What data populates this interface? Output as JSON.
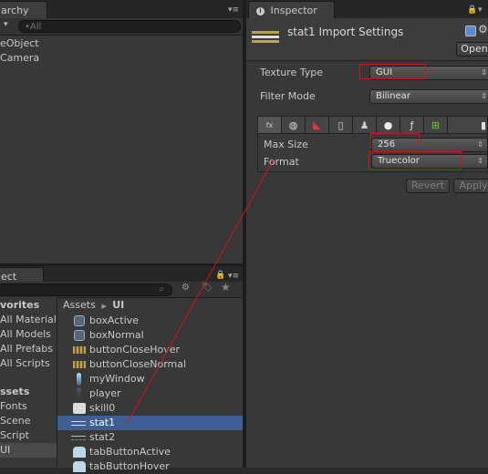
{
  "hierarchy": {
    "tab_label": "archy",
    "create_label": "▾",
    "search_placeholder": "•All",
    "items": [
      "eObject",
      "Camera"
    ]
  },
  "project": {
    "tab_label": "ect",
    "favorites": {
      "header": "vorites",
      "items": [
        "All Material",
        "All Models",
        "All Prefabs",
        "All Scripts"
      ]
    },
    "assets": {
      "header": "ssets",
      "items": [
        "Fonts",
        "Scene",
        "Script",
        "UI"
      ]
    },
    "breadcrumb": {
      "root": "Assets",
      "separator": "▶",
      "current": "UI"
    },
    "files": [
      {
        "name": "boxActive",
        "icon": "circle-frame-icon"
      },
      {
        "name": "boxNormal",
        "icon": "circle-frame-icon"
      },
      {
        "name": "buttonCloseHover",
        "icon": "striped-image-icon"
      },
      {
        "name": "buttonCloseNormal",
        "icon": "striped-image-icon"
      },
      {
        "name": "myWindow",
        "icon": "figure-icon"
      },
      {
        "name": "player",
        "icon": "figure-icon"
      },
      {
        "name": "skill0",
        "icon": "robot-icon"
      },
      {
        "name": "stat1",
        "icon": "bar-icon"
      },
      {
        "name": "stat2",
        "icon": "bar-icon"
      },
      {
        "name": "tabButtonActive",
        "icon": "tab-image-icon"
      },
      {
        "name": "tabButtonHover",
        "icon": "tab-image-icon"
      }
    ],
    "selected_index": 7
  },
  "inspector": {
    "tab_label": "Inspector",
    "title": "stat1 Import Settings",
    "open_label": "Open",
    "texture_type_label": "Texture Type",
    "texture_type_value": "GUI",
    "filter_mode_label": "Filter Mode",
    "filter_mode_value": "Bilinear",
    "max_size_label": "Max Size",
    "max_size_value": "256",
    "format_label": "Format",
    "format_value": "Truecolor",
    "revert_label": "Revert",
    "apply_label": "Apply",
    "platforms": [
      "default-icon",
      "web-globe-icon",
      "standalone-icon",
      "iphone-icon",
      "android-icon",
      "blackberry-icon",
      "flash-icon",
      "windows-store-icon",
      "windows-phone-icon"
    ]
  },
  "colors": {
    "accent_selection": "#3d5f96",
    "annotation_red": "#d01515"
  }
}
